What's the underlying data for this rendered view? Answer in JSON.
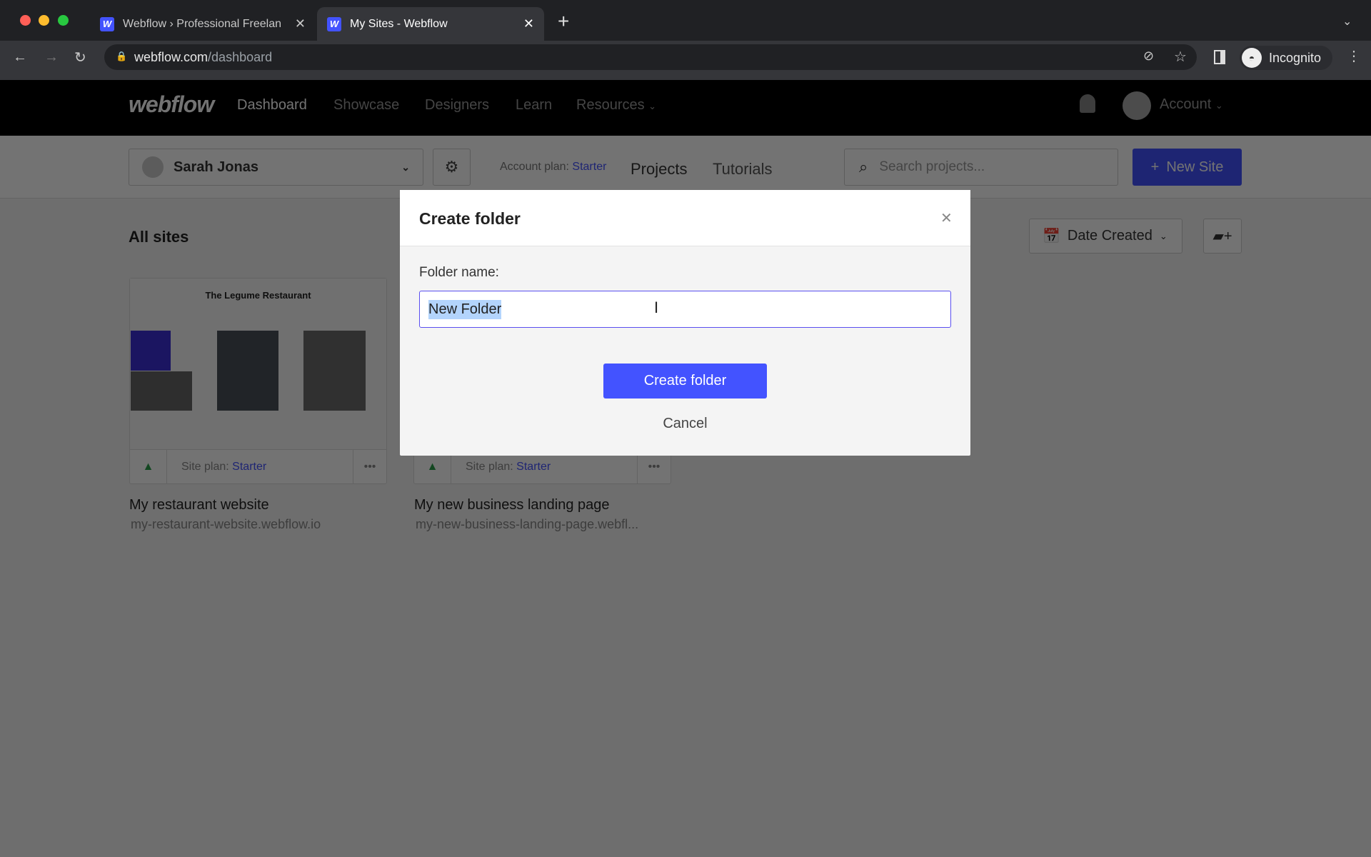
{
  "browser": {
    "tabs": [
      {
        "title": "Webflow › Professional Freelan",
        "active": false
      },
      {
        "title": "My Sites - Webflow",
        "active": true
      }
    ],
    "url_host": "webflow.com",
    "url_path": "/dashboard",
    "profile": "Incognito"
  },
  "nav": {
    "logo": "webflow",
    "items": [
      "Dashboard",
      "Showcase",
      "Designers",
      "Learn",
      "Resources"
    ],
    "account": "Account"
  },
  "subheader": {
    "workspace": "Sarah Jonas",
    "plan_label": "Account plan:",
    "plan_value": "Starter",
    "projects": "Projects",
    "tutorials": "Tutorials",
    "search_placeholder": "Search projects...",
    "new_site": "New Site"
  },
  "main": {
    "title": "All sites",
    "sort": "Date Created",
    "sites": [
      {
        "thumb_title": "The Legume Restaurant",
        "plan_label": "Site plan:",
        "plan": "Starter",
        "name": "My restaurant website",
        "url": "my-restaurant-website.webflow.io"
      },
      {
        "plan_label": "Site plan:",
        "plan": "Starter",
        "name": "My new business landing page",
        "url": "my-new-business-landing-page.webfl..."
      }
    ]
  },
  "modal": {
    "title": "Create folder",
    "label": "Folder name:",
    "value": "New Folder",
    "submit": "Create folder",
    "cancel": "Cancel"
  },
  "colors": {
    "accent": "#4353ff",
    "selection": "#b3d4fc"
  }
}
